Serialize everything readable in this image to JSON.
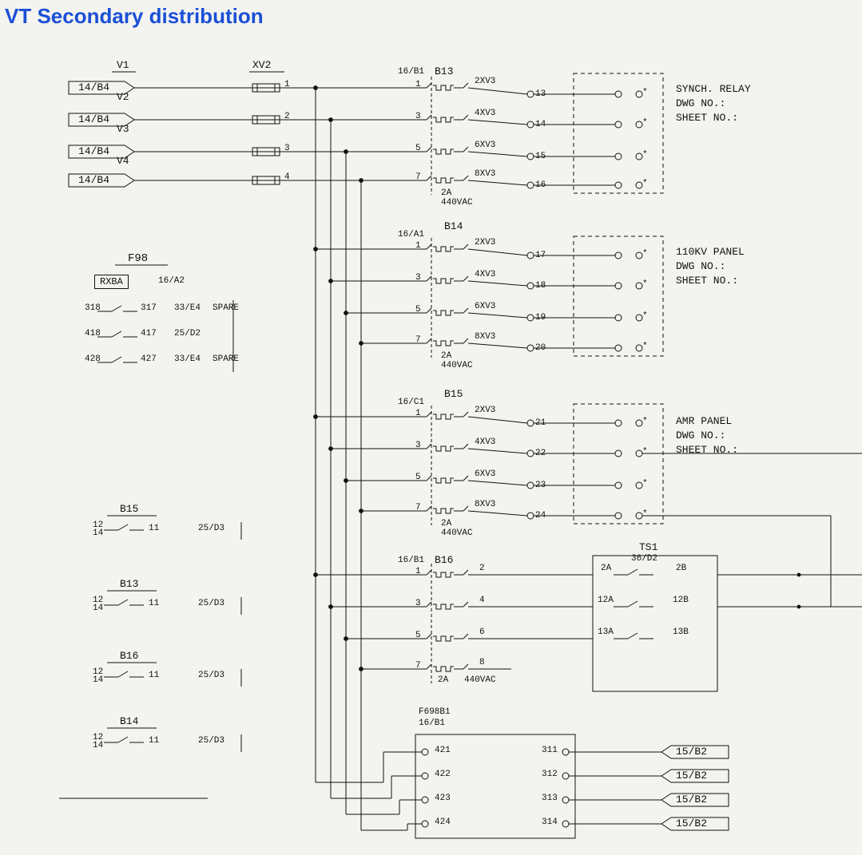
{
  "title": "VT Secondary\ndistribution",
  "inputs": {
    "column_header_v": "V1",
    "column_header_xv2": "XV2",
    "rows": [
      {
        "v": "V1",
        "ref": "14/B4",
        "term": "1"
      },
      {
        "v": "V2",
        "ref": "14/B4",
        "term": "2"
      },
      {
        "v": "V3",
        "ref": "14/B4",
        "term": "3"
      },
      {
        "v": "V4",
        "ref": "14/B4",
        "term": "4"
      }
    ]
  },
  "blocks": [
    {
      "id": "B13",
      "ref": "16/B1",
      "rating": "2A\n440VAC",
      "rows": [
        {
          "l": "1",
          "xv": "2XV3",
          "t": "13"
        },
        {
          "l": "3",
          "xv": "4XV3",
          "t": "14"
        },
        {
          "l": "5",
          "xv": "6XV3",
          "t": "15"
        },
        {
          "l": "7",
          "xv": "8XV3",
          "t": "16"
        }
      ],
      "dest": {
        "name": "SYNCH. RELAY",
        "dwg": "DWG NO.:",
        "sheet": "SHEET NO.:"
      }
    },
    {
      "id": "B14",
      "ref": "16/A1",
      "rating": "2A\n440VAC",
      "rows": [
        {
          "l": "1",
          "xv": "2XV3",
          "t": "17"
        },
        {
          "l": "3",
          "xv": "4XV3",
          "t": "18"
        },
        {
          "l": "5",
          "xv": "6XV3",
          "t": "19"
        },
        {
          "l": "7",
          "xv": "8XV3",
          "t": "20"
        }
      ],
      "dest": {
        "name": "110KV PANEL",
        "dwg": "DWG NO.:",
        "sheet": "SHEET NO.:"
      }
    },
    {
      "id": "B15",
      "ref": "16/C1",
      "rating": "2A\n440VAC",
      "rows": [
        {
          "l": "1",
          "xv": "2XV3",
          "t": "21"
        },
        {
          "l": "3",
          "xv": "4XV3",
          "t": "22"
        },
        {
          "l": "5",
          "xv": "6XV3",
          "t": "23"
        },
        {
          "l": "7",
          "xv": "8XV3",
          "t": "24"
        }
      ],
      "dest": {
        "name": "AMR PANEL",
        "dwg": "DWG NO.:",
        "sheet": "SHEET NO.:"
      }
    },
    {
      "id": "B16",
      "ref": "16/B1",
      "rating": "2A   440VAC",
      "rows": [
        {
          "l": "1",
          "r": "2"
        },
        {
          "l": "3",
          "r": "4"
        },
        {
          "l": "5",
          "r": "6"
        },
        {
          "l": "7",
          "r": "8"
        }
      ]
    }
  ],
  "ts1": {
    "id": "TS1",
    "ref": "36/D2",
    "rows": [
      {
        "l": "2A",
        "r": "2B"
      },
      {
        "l": "12A",
        "r": "12B"
      },
      {
        "l": "13A",
        "r": "13B"
      }
    ]
  },
  "f98_block": {
    "id": "F98",
    "rxba": "RXBA",
    "ref": "16/A2",
    "rows": [
      {
        "l": "318",
        "r": "317",
        "note": "33/E4",
        "spare": "SPARE"
      },
      {
        "l": "418",
        "r": "417",
        "note": "25/D2",
        "spare": ""
      },
      {
        "l": "428",
        "r": "427",
        "note": "33/E4",
        "spare": "SPARE"
      }
    ]
  },
  "mini_blocks": [
    {
      "id": "B15",
      "l1": "12",
      "l2": "14",
      "r": "11",
      "note": "25/D3"
    },
    {
      "id": "B13",
      "l1": "12",
      "l2": "14",
      "r": "11",
      "note": "25/D3"
    },
    {
      "id": "B16",
      "l1": "12",
      "l2": "14",
      "r": "11",
      "note": "25/D3"
    },
    {
      "id": "B14",
      "l1": "12",
      "l2": "14",
      "r": "11",
      "note": "25/D3"
    }
  ],
  "f98_lower": {
    "id": "F698B1",
    "ref": "16/B1",
    "left": [
      "421",
      "422",
      "423",
      "424"
    ],
    "right": [
      "311",
      "312",
      "313",
      "314"
    ]
  },
  "outputs": {
    "ref": "15/B2"
  }
}
